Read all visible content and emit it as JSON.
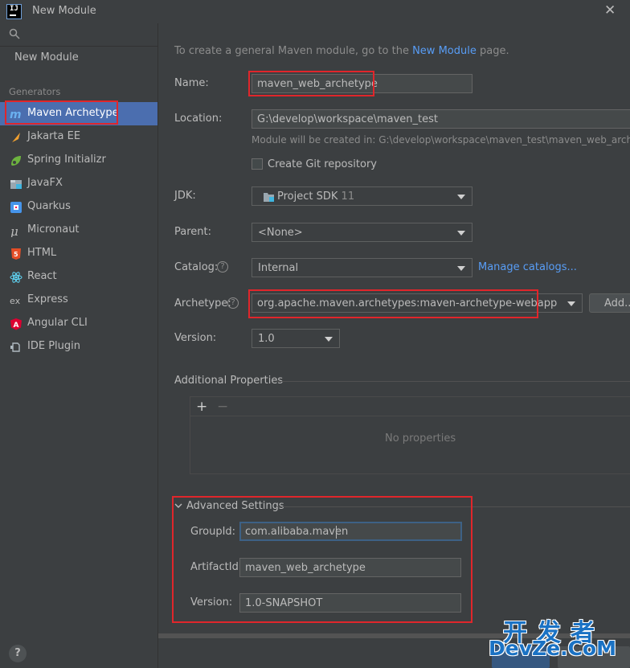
{
  "window": {
    "title": "New Module",
    "close_glyph": "✕"
  },
  "sidebar": {
    "search_icon": "search-icon",
    "new_module": "New Module",
    "generators_label": "Generators",
    "items": [
      {
        "label": "Maven Archetype",
        "icon": "maven-icon",
        "selected": true
      },
      {
        "label": "Jakarta EE",
        "icon": "jakarta-icon"
      },
      {
        "label": "Spring Initializr",
        "icon": "spring-icon"
      },
      {
        "label": "JavaFX",
        "icon": "javafx-icon"
      },
      {
        "label": "Quarkus",
        "icon": "quarkus-icon"
      },
      {
        "label": "Micronaut",
        "icon": "micronaut-icon"
      },
      {
        "label": "HTML",
        "icon": "html5-icon"
      },
      {
        "label": "React",
        "icon": "react-icon"
      },
      {
        "label": "Express",
        "icon": "express-icon"
      },
      {
        "label": "Angular CLI",
        "icon": "angular-icon"
      },
      {
        "label": "IDE Plugin",
        "icon": "plugin-icon"
      }
    ],
    "help": "?"
  },
  "main": {
    "intro_prefix": "To create a general Maven module, go to the ",
    "intro_link": "New Module",
    "intro_suffix": " page.",
    "name_label": "Name:",
    "name_value": "maven_web_archetype",
    "location_label": "Location:",
    "location_value": "G:\\develop\\workspace\\maven_test",
    "location_hint": "Module will be created in: G:\\develop\\workspace\\maven_test\\maven_web_archetype",
    "git_label": "Create Git repository",
    "git_checked": false,
    "jdk_label": "JDK:",
    "jdk_value": "Project SDK",
    "jdk_version": "11",
    "parent_label": "Parent:",
    "parent_value": "<None>",
    "catalog_label": "Catalog:",
    "catalog_value": "Internal",
    "manage_catalogs": "Manage catalogs...",
    "archetype_label": "Archetype:",
    "archetype_value": "org.apache.maven.archetypes:maven-archetype-webapp",
    "archetype_add": "Add...",
    "version_label": "Version:",
    "version_value": "1.0",
    "additional_props_label": "Additional Properties",
    "add_glyph": "+",
    "remove_glyph": "−",
    "no_properties": "No properties",
    "advanced_label": "Advanced Settings",
    "groupid_label": "GroupId:",
    "groupid_value": "com.alibaba.maven",
    "artifactid_label": "ArtifactId:",
    "artifactid_value": "maven_web_archetype",
    "adv_version_label": "Version:",
    "adv_version_value": "1.0-SNAPSHOT"
  },
  "watermark": {
    "cn": "开发者",
    "en": "DevZe.CoM"
  },
  "colors": {
    "accent": "#4b6eaf",
    "highlight_box": "#e0262b",
    "link": "#589df6"
  }
}
